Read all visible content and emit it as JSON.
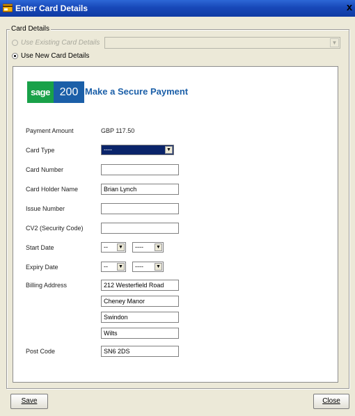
{
  "window": {
    "title": "Enter Card Details",
    "close_glyph": "x",
    "icon": "card-window-icon"
  },
  "group": {
    "legend": "Card Details",
    "existing_label": "Use Existing Card Details",
    "new_label": "Use New Card Details",
    "selected_option": "Use New Card Details"
  },
  "logo": {
    "part1": "sage",
    "part2": "200",
    "heading": "Make a Secure Payment",
    "colors": {
      "green": "#19a149",
      "blue": "#1b5fa8"
    }
  },
  "form": {
    "payment_amount_label": "Payment Amount",
    "payment_amount_value": "GBP 117.50",
    "card_type_label": "Card Type",
    "card_type_value": "----",
    "card_number_label": "Card Number",
    "card_number_value": "",
    "card_holder_label": "Card Holder Name",
    "card_holder_value": "Brian Lynch",
    "issue_number_label": "Issue Number",
    "issue_number_value": "",
    "cv2_label": "CV2 (Security Code)",
    "cv2_value": "",
    "start_date_label": "Start Date",
    "start_month": "--",
    "start_year": "----",
    "expiry_date_label": "Expiry Date",
    "expiry_month": "--",
    "expiry_year": "----",
    "billing_address_label": "Billing Address",
    "address_line1": "212 Westerfield Road",
    "address_line2": "Cheney Manor",
    "address_line3": "Swindon",
    "address_line4": "Wilts",
    "post_code_label": "Post Code",
    "post_code_value": "SN6 2DS"
  },
  "buttons": {
    "save": "Save",
    "close": "Close"
  },
  "colors": {
    "titlebar": "#1848b8",
    "dialog_bg": "#ece9d8",
    "selected_combo": "#0a246a"
  }
}
